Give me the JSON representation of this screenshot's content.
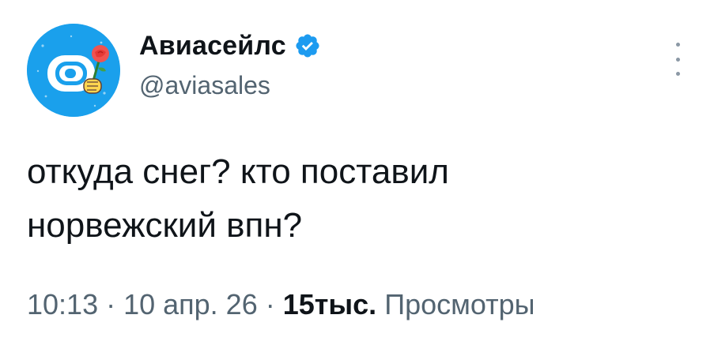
{
  "author": {
    "display_name": "Авиасейлс",
    "handle": "@aviasales",
    "verified": true,
    "avatar_icon": "aviasales-logo-icon",
    "avatar_color": "#1aa0ec"
  },
  "tweet": {
    "text_lines": [
      "откуда снег? кто поставил",
      "норвежский впн?"
    ]
  },
  "meta": {
    "time": "10:13",
    "separator": " · ",
    "date": "10 апр. 26",
    "views_count": "15тыс.",
    "views_label": " Просмотры"
  },
  "colors": {
    "text": "#0f1419",
    "secondary": "#536471",
    "verified": "#1d9bf0"
  }
}
